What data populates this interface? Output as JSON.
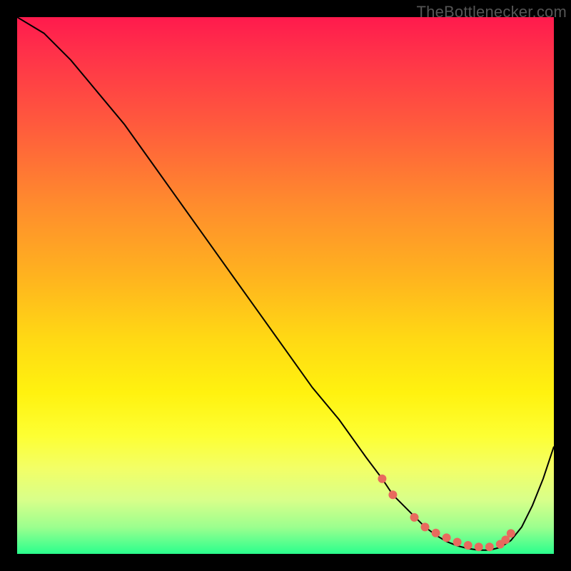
{
  "watermark": "TheBottlenecker.com",
  "chart_data": {
    "type": "line",
    "title": "",
    "xlabel": "",
    "ylabel": "",
    "xlim": [
      0,
      100
    ],
    "ylim": [
      0,
      100
    ],
    "x": [
      0,
      5,
      10,
      15,
      20,
      25,
      30,
      35,
      40,
      45,
      50,
      55,
      60,
      65,
      68,
      70,
      72,
      74,
      76,
      78,
      80,
      82,
      84,
      86,
      88,
      90,
      92,
      94,
      96,
      98,
      100
    ],
    "values": [
      100,
      97,
      92,
      86,
      80,
      73,
      66,
      59,
      52,
      45,
      38,
      31,
      25,
      18,
      14,
      11,
      9,
      7,
      5,
      3.5,
      2.3,
      1.5,
      1,
      0.7,
      0.7,
      1.2,
      2.5,
      5,
      9,
      14,
      20
    ],
    "flat_region_x": [
      74,
      90
    ],
    "marker_points": {
      "x": [
        68,
        70,
        74,
        76,
        78,
        80,
        82,
        84,
        86,
        88,
        90,
        91,
        92
      ],
      "y": [
        14,
        11,
        6.8,
        5.0,
        3.9,
        3.0,
        2.2,
        1.6,
        1.3,
        1.3,
        1.8,
        2.6,
        3.8
      ]
    }
  }
}
